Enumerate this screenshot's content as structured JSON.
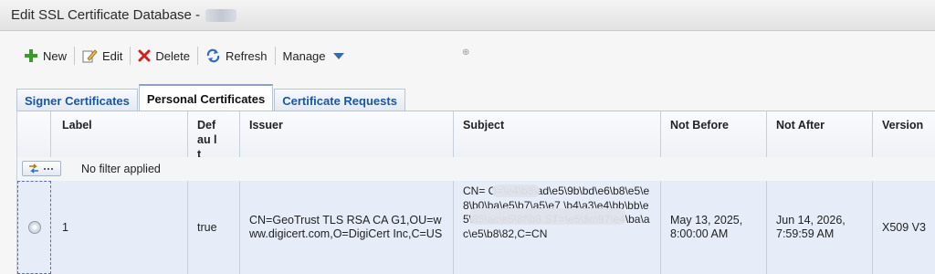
{
  "window": {
    "title": "Edit SSL Certificate Database -"
  },
  "toolbar": {
    "new_label": "New",
    "edit_label": "Edit",
    "delete_label": "Delete",
    "refresh_label": "Refresh",
    "manage_label": "Manage"
  },
  "tabs": [
    {
      "label": "Signer Certificates",
      "active": false
    },
    {
      "label": "Personal Certificates",
      "active": true
    },
    {
      "label": "Certificate Requests",
      "active": false
    }
  ],
  "table": {
    "columns": [
      "Label",
      "Defau lt",
      "Issuer",
      "Subject",
      "Not Before",
      "Not After",
      "Version"
    ],
    "filter_text": "No filter applied",
    "rows": [
      {
        "label": "1",
        "default": "true",
        "issuer": "CN=GeoTrust TLS RSA CA G1,OU=www.digicert.com,O=DigiCert Inc,C=US",
        "subject": "CN=          O=\\e4\\b8\\ad\\e5\\9b\\bd\\e6\\b8\\e5\\e8\\b0\\ba\\e5\\b7\\a5\\e7                    \\b4\\a3\\e4\\bb\\bb\\e5\\85\\ac\\e5\\8f\\b8,ST=\\e5\\8c\\97\\e4\\ba\\ac\\e5\\b8\\82,C=CN",
        "not_before": "May 13, 2025, 8:00:00 AM",
        "not_after": "Jun 14, 2026, 7:59:59 AM",
        "version": "X509 V3"
      }
    ]
  },
  "colors": {
    "tab_text": "#1b56a0",
    "selected_row": "#e6edf8",
    "delete_icon": "#cc2222",
    "new_icon": "#3a9a2a"
  }
}
